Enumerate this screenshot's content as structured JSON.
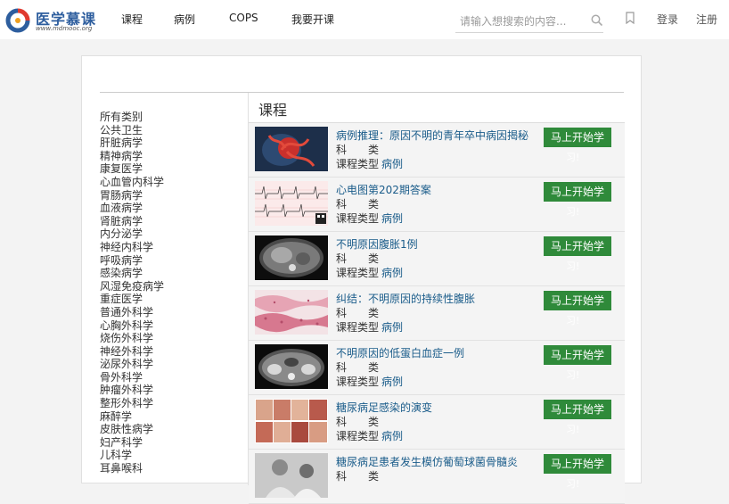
{
  "header": {
    "logo_title": "医学慕课",
    "logo_subtitle": "www.mdmooc.org",
    "nav": [
      "课程",
      "病例",
      "COPS",
      "我要开课"
    ],
    "search_placeholder": "请输入想搜索的内容...",
    "login": "登录",
    "register": "注册"
  },
  "categories": [
    "所有类别",
    "公共卫生",
    "肝脏病学",
    "精神病学",
    "康复医学",
    "心血管内科学",
    "胃肠病学",
    "血液病学",
    "肾脏病学",
    "内分泌学",
    "神经内科学",
    "呼吸病学",
    "感染病学",
    "风湿免疫病学",
    "重症医学",
    "普通外科学",
    "心胸外科学",
    "烧伤外科学",
    "神经外科学",
    "泌尿外科学",
    "骨外科学",
    "肿瘤外科学",
    "整形外科学",
    "麻醉学",
    "皮肤性病学",
    "妇产科学",
    "儿科学",
    "耳鼻喉科"
  ],
  "content": {
    "title": "课程",
    "subject_label": "科　　类",
    "type_label": "课程类型",
    "button_label": "马上开始学",
    "button_wrap": "习!",
    "courses": [
      {
        "title": "病例推理：原因不明的青年卒中病因揭秘",
        "type": "病例",
        "thumb": "brain-vessels"
      },
      {
        "title": "心电图第202期答案",
        "type": "病例",
        "thumb": "ecg"
      },
      {
        "title": "不明原因腹胀1例",
        "type": "病例",
        "thumb": "ct-abdomen"
      },
      {
        "title": "纠结：不明原因的持续性腹胀",
        "type": "病例",
        "thumb": "histology"
      },
      {
        "title": "不明原因的低蛋白血症一例",
        "type": "病例",
        "thumb": "ct-pelvis"
      },
      {
        "title": "糖尿病足感染的演变",
        "type": "病例",
        "thumb": "foot-photos"
      },
      {
        "title": "糖尿病足患者发生模仿葡萄球菌骨髓炎",
        "type": "",
        "thumb": "patient-photo"
      }
    ]
  }
}
